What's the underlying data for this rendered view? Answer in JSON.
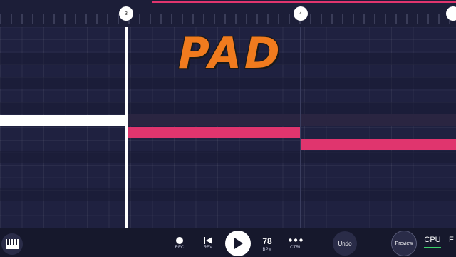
{
  "timeline": {
    "markers": [
      "3",
      "4"
    ]
  },
  "overlay": {
    "title": "PAD"
  },
  "toolbar": {
    "rec_label": "REC",
    "rev_label": "REV",
    "bpm_value": "78",
    "bpm_label": "BPM",
    "ctrl_label": "CTRL",
    "undo_label": "Undo",
    "preview_label": "Preview",
    "cpu_label": "CPU",
    "f_label": "F"
  },
  "icons": {
    "piano": "piano-icon",
    "rec": "record-icon",
    "rev": "rewind-icon",
    "play": "play-icon",
    "ctrl": "more-dots-icon"
  },
  "colors": {
    "accent": "#e0356e",
    "title": "#f07b1e",
    "note_selected": "#ffffff",
    "cpu_meter": "#3cd16a"
  }
}
